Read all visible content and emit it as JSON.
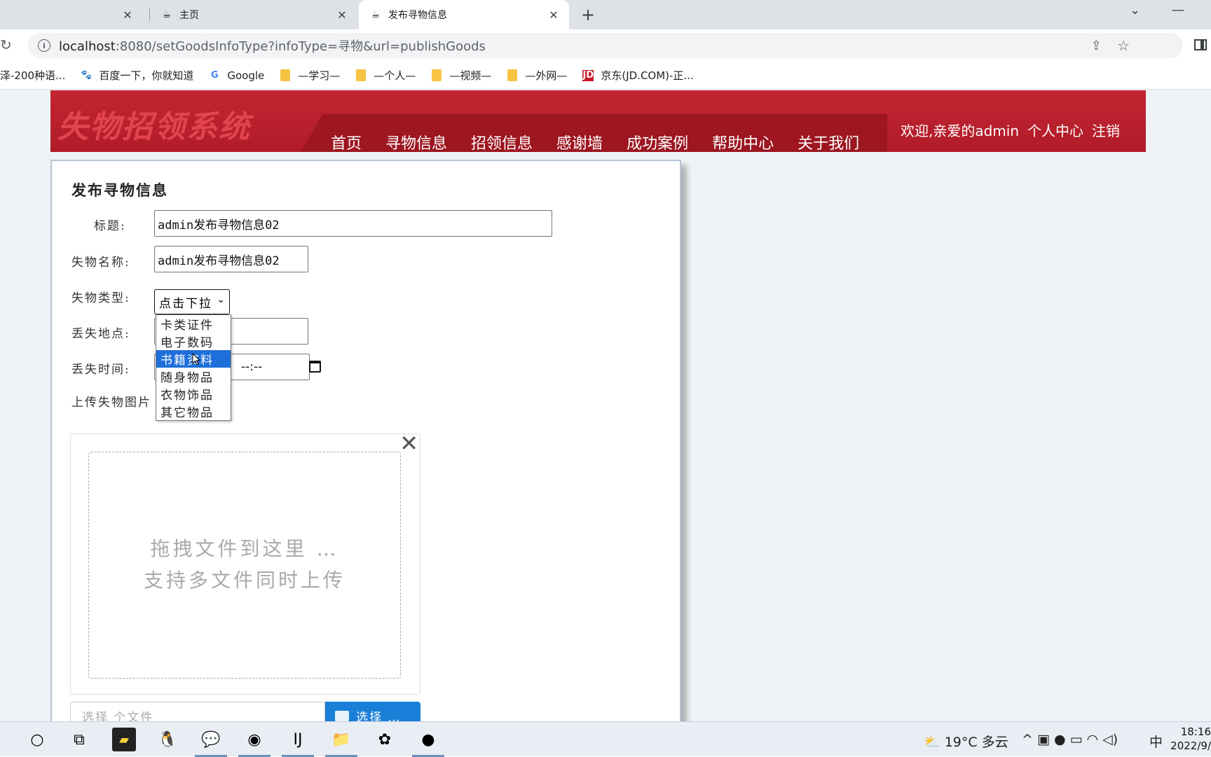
{
  "browser": {
    "tabs": [
      {
        "title": "",
        "active": false
      },
      {
        "title": "主页",
        "active": false
      },
      {
        "title": "发布寻物信息",
        "active": true
      }
    ],
    "url_host": "localhost",
    "url_rest": ":8080/setGoodsInfoType?infoType=寻物&url=publishGoods",
    "bookmarks": [
      {
        "label": "泽-200种语...",
        "icon": "none"
      },
      {
        "label": "百度一下，你就知道",
        "icon": "baidu-icon"
      },
      {
        "label": "Google",
        "icon": "google-icon"
      },
      {
        "label": "—学习—",
        "icon": "folder-icon"
      },
      {
        "label": "—个人—",
        "icon": "folder-icon"
      },
      {
        "label": "—视频—",
        "icon": "folder-icon"
      },
      {
        "label": "—外网—",
        "icon": "folder-icon"
      },
      {
        "label": "京东(JD.COM)-正...",
        "icon": "jd-icon"
      }
    ]
  },
  "site": {
    "logo": "失物招领系统",
    "nav": [
      "首页",
      "寻物信息",
      "招领信息",
      "感谢墙",
      "成功案例",
      "帮助中心",
      "关于我们"
    ],
    "welcome": "欢迎,亲爱的admin",
    "profile": "个人中心",
    "logout": "注销",
    "colors": {
      "header": "#b31f2b",
      "accent": "#1a7fd8"
    }
  },
  "form": {
    "title": "发布寻物信息",
    "title_label": "标题:",
    "title_value": "admin发布寻物信息02",
    "name_label": "失物名称:",
    "name_value": "admin发布寻物信息02",
    "type_label": "失物类型:",
    "type_value": "点击下拉",
    "type_options": [
      "卡类证件",
      "电子数码",
      "书籍资料",
      "随身物品",
      "衣物饰品",
      "其它物品"
    ],
    "type_highlighted": "书籍资料",
    "place_label": "丢失地点:",
    "time_label": "丢失时间:",
    "time_value": "--:--",
    "upload_label": "上传失物图片",
    "drop_line1": "拖拽文件到这里 …",
    "drop_line2": "支持多文件同时上传",
    "file_placeholder": "选择 个文件",
    "choose_button": "选择 …"
  },
  "taskbar": {
    "weather": "19°C 多云",
    "ime": "中",
    "time": "18:16",
    "date": "2022/9/"
  }
}
